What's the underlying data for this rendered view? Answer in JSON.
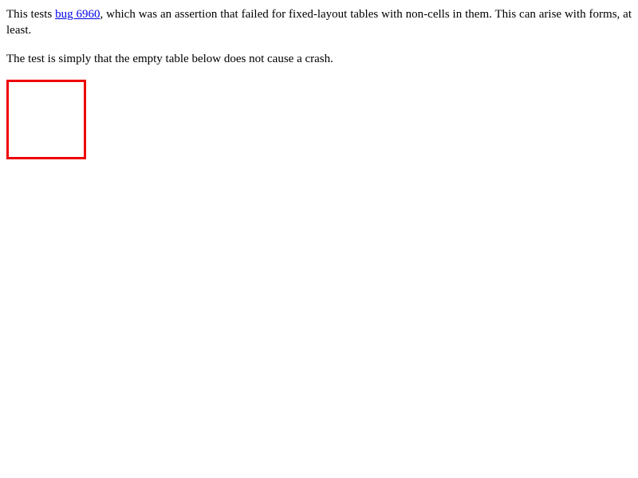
{
  "intro": {
    "prefix": "This tests ",
    "link_text": "bug 6960",
    "suffix": ", which was an assertion that failed for fixed-layout tables with non-cells in them. This can arise with forms, at least."
  },
  "description": "The test is simply that the empty table below does not cause a crash.",
  "colors": {
    "link": "#0000ee",
    "table_border": "#ee0000"
  }
}
